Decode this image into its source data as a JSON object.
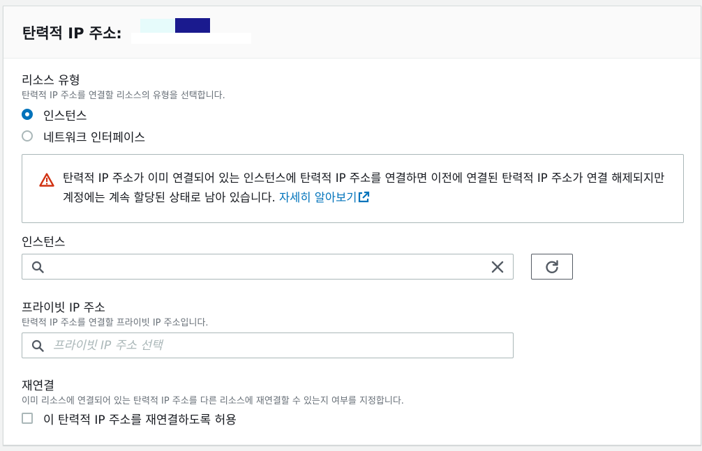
{
  "header": {
    "title": "탄력적 IP 주소:"
  },
  "resource_type": {
    "label": "리소스 유형",
    "description": "탄력적 IP 주소를 연결할 리소스의 유형을 선택합니다.",
    "options": [
      {
        "label": "인스턴스",
        "selected": true
      },
      {
        "label": "네트워크 인터페이스",
        "selected": false
      }
    ]
  },
  "alert": {
    "text": "탄력적 IP 주소가 이미 연결되어 있는 인스턴스에 탄력적 IP 주소를 연결하면 이전에 연결된 탄력적 IP 주소가 연결 해제되지만 계정에는 계속 할당된 상태로 남아 있습니다. ",
    "link_label": "자세히 알아보기",
    "icon": "warning-icon"
  },
  "instance": {
    "label": "인스턴스",
    "value": "",
    "placeholder": ""
  },
  "private_ip": {
    "label": "프라이빗 IP 주소",
    "description": "탄력적 IP 주소를 연결할 프라이빗 IP 주소입니다.",
    "placeholder": "프라이빗 IP 주소 선택"
  },
  "reassociation": {
    "label": "재연결",
    "description": "이미 리소스에 연결되어 있는 탄력적 IP 주소를 다른 리소스에 재연결할 수 있는지 여부를 지정합니다.",
    "checkbox_label": "이 탄력적 IP 주소를 재연결하도록 허용",
    "checked": false
  },
  "colors": {
    "accent": "#0073bb",
    "warning": "#d13212",
    "border": "#aab7b8"
  }
}
